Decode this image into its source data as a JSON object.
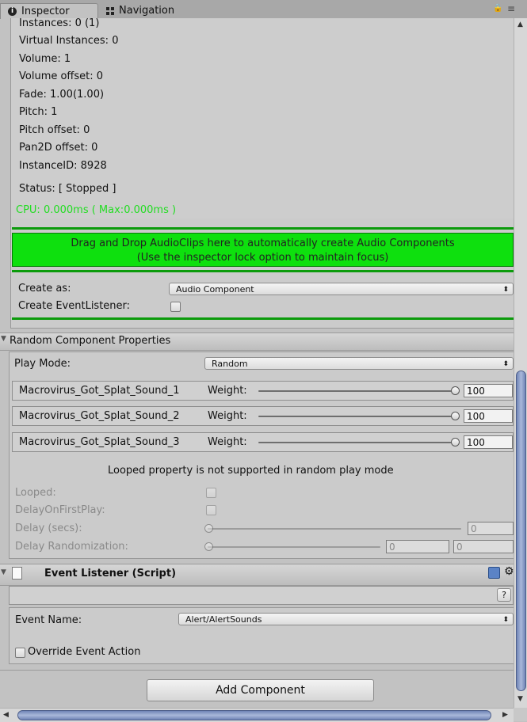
{
  "tabs": {
    "inspector": "Inspector",
    "navigation": "Navigation",
    "lock_glyph": "🔒",
    "menu_glyph": "≡"
  },
  "stats": {
    "instances": "Instances: 0 (1)",
    "virtual_instances": "Virtual Instances: 0",
    "volume": "Volume: 1",
    "volume_offset": "Volume offset: 0",
    "fade": "Fade: 1.00(1.00)",
    "pitch": "Pitch: 1",
    "pitch_offset": "Pitch offset: 0",
    "pan2d_offset": "Pan2D offset: 0",
    "instance_id": "InstanceID: 8928",
    "status": "Status: [ Stopped ]",
    "cpu": "CPU: 0.000ms ( Max:0.000ms )"
  },
  "dropzone": {
    "line1": "Drag and Drop AudioClips here to automatically create Audio Components",
    "line2": "(Use the inspector lock option to maintain focus)"
  },
  "create": {
    "create_as_label": "Create as:",
    "create_as_value": "Audio Component",
    "create_listener_label": "Create EventListener:"
  },
  "random": {
    "header": "Random Component Properties",
    "play_mode_label": "Play Mode:",
    "play_mode_value": "Random",
    "sounds": [
      {
        "name": "Macrovirus_Got_Splat_Sound_1",
        "weight_label": "Weight:",
        "weight": "100",
        "level": 1.0
      },
      {
        "name": "Macrovirus_Got_Splat_Sound_2",
        "weight_label": "Weight:",
        "weight": "100",
        "level": 1.0
      },
      {
        "name": "Macrovirus_Got_Splat_Sound_3",
        "weight_label": "Weight:",
        "weight": "100",
        "level": 1.0
      }
    ],
    "note": "Looped property is not supported in random play mode",
    "looped_label": "Looped:",
    "delay_first_label": "DelayOnFirstPlay:",
    "delay_label": "Delay (secs):",
    "delay_value": "0",
    "delay_rand_label": "Delay Randomization:",
    "delay_rand_min": "0",
    "delay_rand_max": "0"
  },
  "event_listener": {
    "header": "Event Listener (Script)",
    "help_glyph": "?",
    "event_name_label": "Event Name:",
    "event_name_value": "Alert/AlertSounds",
    "override_label": "Override Event Action"
  },
  "footer": {
    "add_component": "Add Component"
  },
  "colors": {
    "dropzone_green": "#0ee00e",
    "cpu_text": "#22dd22",
    "scroll_thumb": "#8093c4"
  }
}
